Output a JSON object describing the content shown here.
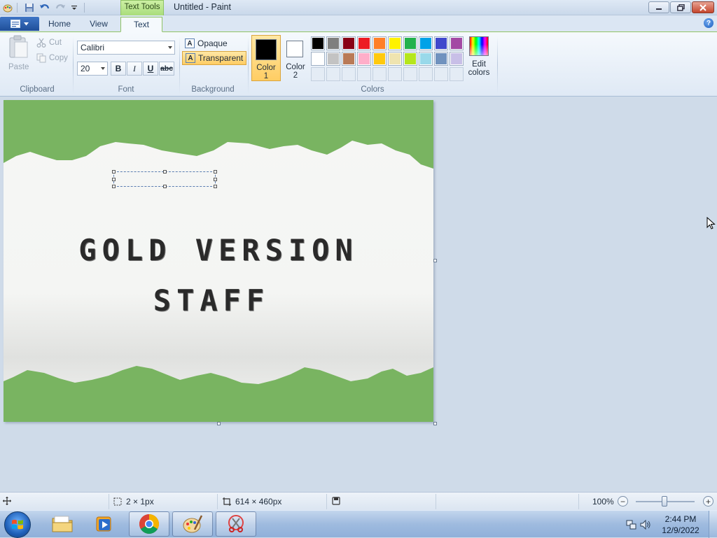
{
  "window": {
    "title": "Untitled - Paint",
    "context_tab": "Text Tools"
  },
  "tabs": {
    "home": "Home",
    "view": "View",
    "text": "Text"
  },
  "clipboard": {
    "paste": "Paste",
    "cut": "Cut",
    "copy": "Copy",
    "label": "Clipboard"
  },
  "font": {
    "family": "Calibri",
    "size": "20",
    "bold": "B",
    "italic": "I",
    "underline": "U",
    "strikethrough": "abc",
    "label": "Font"
  },
  "background": {
    "opaque": "Opaque",
    "transparent": "Transparent",
    "label": "Background",
    "selected": "transparent"
  },
  "colors": {
    "color1_label_line1": "Color",
    "color1_label_line2": "1",
    "color2_label_line1": "Color",
    "color2_label_line2": "2",
    "color1": "#000000",
    "color2": "#ffffff",
    "palette_row1": [
      "#000000",
      "#7f7f7f",
      "#880015",
      "#ed1c24",
      "#ff7f27",
      "#fff200",
      "#22b14c",
      "#00a2e8",
      "#3f48cc",
      "#a349a4"
    ],
    "palette_row2": [
      "#ffffff",
      "#c3c3c3",
      "#b97a57",
      "#ffaec9",
      "#ffc90e",
      "#efe4b0",
      "#b5e61d",
      "#99d9ea",
      "#7092be",
      "#c8bfe7"
    ],
    "edit_colors_line1": "Edit",
    "edit_colors_line2": "colors",
    "label": "Colors"
  },
  "canvas": {
    "line1": "GOLD VERSION",
    "line2": "STAFF",
    "band_color": "#79b461"
  },
  "status": {
    "selection_size": "2 × 1px",
    "image_size": "614 × 460px",
    "zoom": "100%"
  },
  "taskbar": {
    "time": "2:44 PM",
    "date": "12/9/2022"
  }
}
